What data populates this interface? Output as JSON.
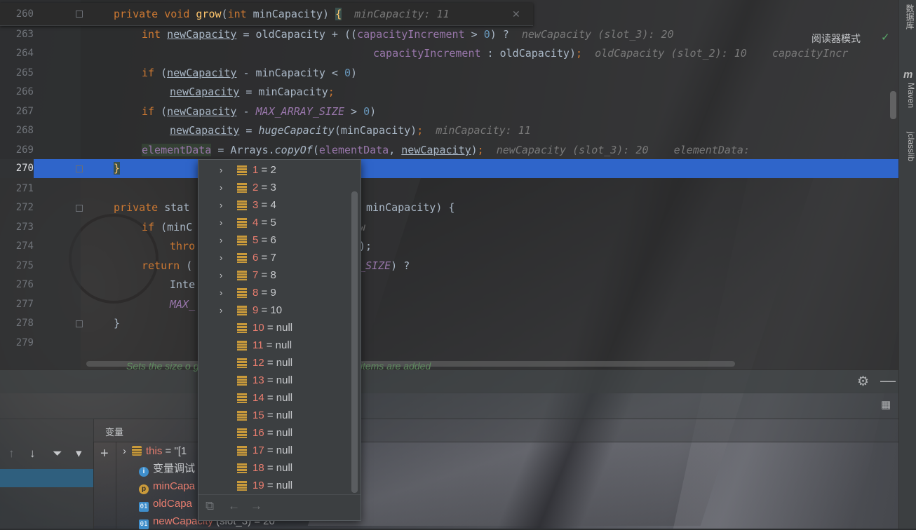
{
  "sticky_line": {
    "num": "260",
    "k_private": "private",
    "k_void": "void",
    "method": "grow",
    "open": "(",
    "k_int": "int",
    "param": " minCapacity) ",
    "brace": "{",
    "hint": "minCapacity: 11",
    "close_icon": "✕"
  },
  "editor": {
    "reader_mode": "阅读器模式",
    "check_icon": "✓",
    "lines": {
      "l263": {
        "num": "263",
        "kw_int": "int",
        "var": "newCapacity",
        "t1": " = oldCapacity + ((",
        "fld": "capacityIncrement",
        "t2": " > ",
        "n0": "0",
        "t3": ") ?  ",
        "hint": "newCapacity (slot_3): 20"
      },
      "l264": {
        "num": "264",
        "fld": "capacityIncrement",
        "t1": " : oldCapacity)",
        "semi": ";",
        "hint": "oldCapacity (slot_2): 10    capacityIncr"
      },
      "l265": {
        "num": "265",
        "kw_if": "if",
        "t1": " (",
        "var": "newCapacity",
        "t2": " - minCapacity < ",
        "n0": "0",
        "t3": ")"
      },
      "l266": {
        "num": "266",
        "var": "newCapacity",
        "t1": " = minCapacity",
        "semi": ";"
      },
      "l267": {
        "num": "267",
        "kw_if": "if",
        "t1": " (",
        "var": "newCapacity",
        "t2": " - ",
        "cst": "MAX_ARRAY_SIZE",
        "t3": " > ",
        "n0": "0",
        "t4": ")"
      },
      "l268": {
        "num": "268",
        "var": "newCapacity",
        "t1": " = ",
        "sfn": "hugeCapacity",
        "t2": "(minCapacity)",
        "semi": ";",
        "hint": "minCapacity: 11"
      },
      "l269": {
        "num": "269",
        "fld": "elementData",
        "t1": " = Arrays.",
        "sfn": "copyOf",
        "t2": "(",
        "fld2": "elementData",
        "t3": ", ",
        "var": "newCapacity",
        "t4": ")",
        "semi": ";",
        "hint": "newCapacity (slot_3): 20    elementData:"
      },
      "l270": {
        "num": "270",
        "brace": "}"
      },
      "l271": {
        "num": "271"
      },
      "l272": {
        "num": "272",
        "kw": "private",
        "t1": " stat",
        "t2": "minCapacity) {"
      },
      "l273": {
        "num": "273",
        "kw_if": "if",
        "t1": " (minC",
        "t2": "w"
      },
      "l274": {
        "num": "274",
        "kw": "thro",
        "t2": ");"
      },
      "l275": {
        "num": "275",
        "kw": "return",
        "t1": " (",
        "cst": "_SIZE",
        "t2": ") ?"
      },
      "l276": {
        "num": "276",
        "t1": "Inte"
      },
      "l277": {
        "num": "277",
        "cst": "MAX_"
      },
      "l278": {
        "num": "278",
        "brace": "}"
      },
      "l279": {
        "num": "279"
      }
    },
    "doc_ghost": "Sets the size o                    greater than the current size, new null items are added"
  },
  "right_sidebar": {
    "database": "数据库",
    "maven_icon": "m",
    "maven": "Maven",
    "jclasslib": "jclasslib"
  },
  "debugger": {
    "variables_title": "变量",
    "gear_icon": "⚙",
    "minimize_icon": "—",
    "layout_icon": "▦",
    "frame_tools": {
      "up": "↑",
      "down": "↓",
      "filter": "⏷",
      "dropdown": "▾"
    },
    "add_icon": "+",
    "variables": [
      {
        "name": "this",
        "value": " = \"[1",
        "icon": "array"
      },
      {
        "name": "变量调试",
        "value": "",
        "icon": "info"
      },
      {
        "name": "minCapa",
        "value": "",
        "icon": "param"
      },
      {
        "name": "oldCapa",
        "value": "",
        "icon": "int"
      },
      {
        "name": "newCapacity",
        "value": " (slot_3) = 20",
        "icon": "int"
      }
    ]
  },
  "popup": {
    "items": [
      {
        "key": "1",
        "val": " = 2",
        "expandable": true
      },
      {
        "key": "2",
        "val": " = 3",
        "expandable": true
      },
      {
        "key": "3",
        "val": " = 4",
        "expandable": true
      },
      {
        "key": "4",
        "val": " = 5",
        "expandable": true
      },
      {
        "key": "5",
        "val": " = 6",
        "expandable": true
      },
      {
        "key": "6",
        "val": " = 7",
        "expandable": true
      },
      {
        "key": "7",
        "val": " = 8",
        "expandable": true
      },
      {
        "key": "8",
        "val": " = 9",
        "expandable": true
      },
      {
        "key": "9",
        "val": " = 10",
        "expandable": true
      },
      {
        "key": "10",
        "val": " = null",
        "expandable": false
      },
      {
        "key": "11",
        "val": " = null",
        "expandable": false
      },
      {
        "key": "12",
        "val": " = null",
        "expandable": false
      },
      {
        "key": "13",
        "val": " = null",
        "expandable": false
      },
      {
        "key": "14",
        "val": " = null",
        "expandable": false
      },
      {
        "key": "15",
        "val": " = null",
        "expandable": false
      },
      {
        "key": "16",
        "val": " = null",
        "expandable": false
      },
      {
        "key": "17",
        "val": " = null",
        "expandable": false
      },
      {
        "key": "18",
        "val": " = null",
        "expandable": false
      },
      {
        "key": "19",
        "val": " = null",
        "expandable": false
      }
    ],
    "footer": {
      "pin": "⧉",
      "back": "←",
      "forward": "→"
    },
    "chevron": "›"
  },
  "colors": {
    "accent": "#2f65ca",
    "keyword": "#cc7832",
    "method": "#ffc66d",
    "field": "#9876aa",
    "number": "#6897bb",
    "index_key": "#e87d6f"
  }
}
